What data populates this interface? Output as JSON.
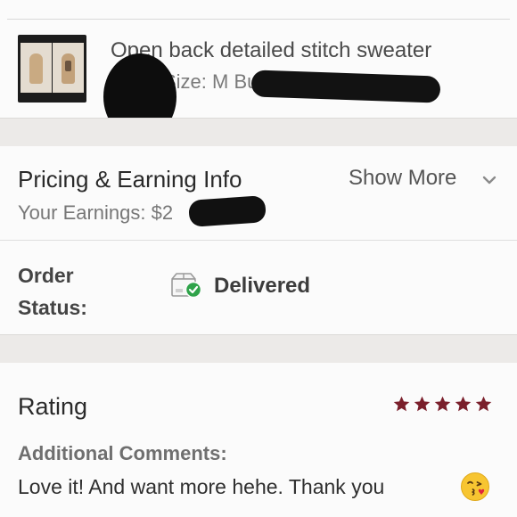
{
  "product": {
    "title": "Open back detailed stitch sweater",
    "subtitle": "Size: M  Buyer:",
    "thumbnail_icon": "product-photo"
  },
  "pricing": {
    "title": "Pricing & Earning Info",
    "earnings": "Your Earnings: $2",
    "show_more": "Show More",
    "chevron_icon": "chevron-down-icon"
  },
  "order": {
    "label": "Order Status:",
    "status": "Delivered",
    "status_icon": "package-delivered-icon",
    "status_color": "#2fa34a"
  },
  "rating": {
    "title": "Rating",
    "stars": 5,
    "max_stars": 5,
    "star_color": "#7a1f2b",
    "comments_label": "Additional Comments:",
    "comment": "Love it! And want more hehe. Thank you",
    "emoji_icon": "face-blowing-kiss-emoji"
  }
}
